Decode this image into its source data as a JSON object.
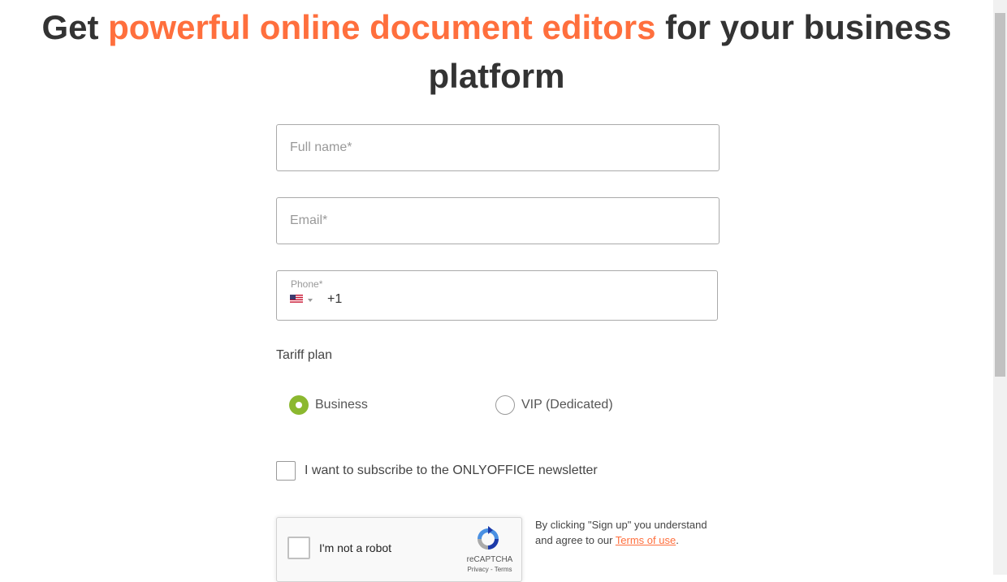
{
  "headline": {
    "prefix": "Get ",
    "accent": "powerful online document editors",
    "suffix": " for your business platform"
  },
  "form": {
    "full_name_placeholder": "Full name*",
    "email_placeholder": "Email*",
    "phone_label": "Phone*",
    "phone_country_icon": "us-flag-icon",
    "phone_dial_code": "+1",
    "tariff_label": "Tariff plan",
    "tariff_options": [
      {
        "label": "Business",
        "selected": true
      },
      {
        "label": "VIP (Dedicated)",
        "selected": false
      }
    ],
    "newsletter_label": "I want to subscribe to the ONLYOFFICE newsletter",
    "newsletter_checked": false
  },
  "captcha": {
    "label": "I'm not a robot",
    "brand": "reCAPTCHA",
    "privacy": "Privacy",
    "separator": " - ",
    "terms": "Terms"
  },
  "terms_note": {
    "text_before": "By clicking \"Sign up\" you understand and agree to our ",
    "link": "Terms of use",
    "text_after": "."
  },
  "colors": {
    "accent": "#ff6f3d",
    "radio_selected": "#8bb82f",
    "text": "#333333"
  }
}
